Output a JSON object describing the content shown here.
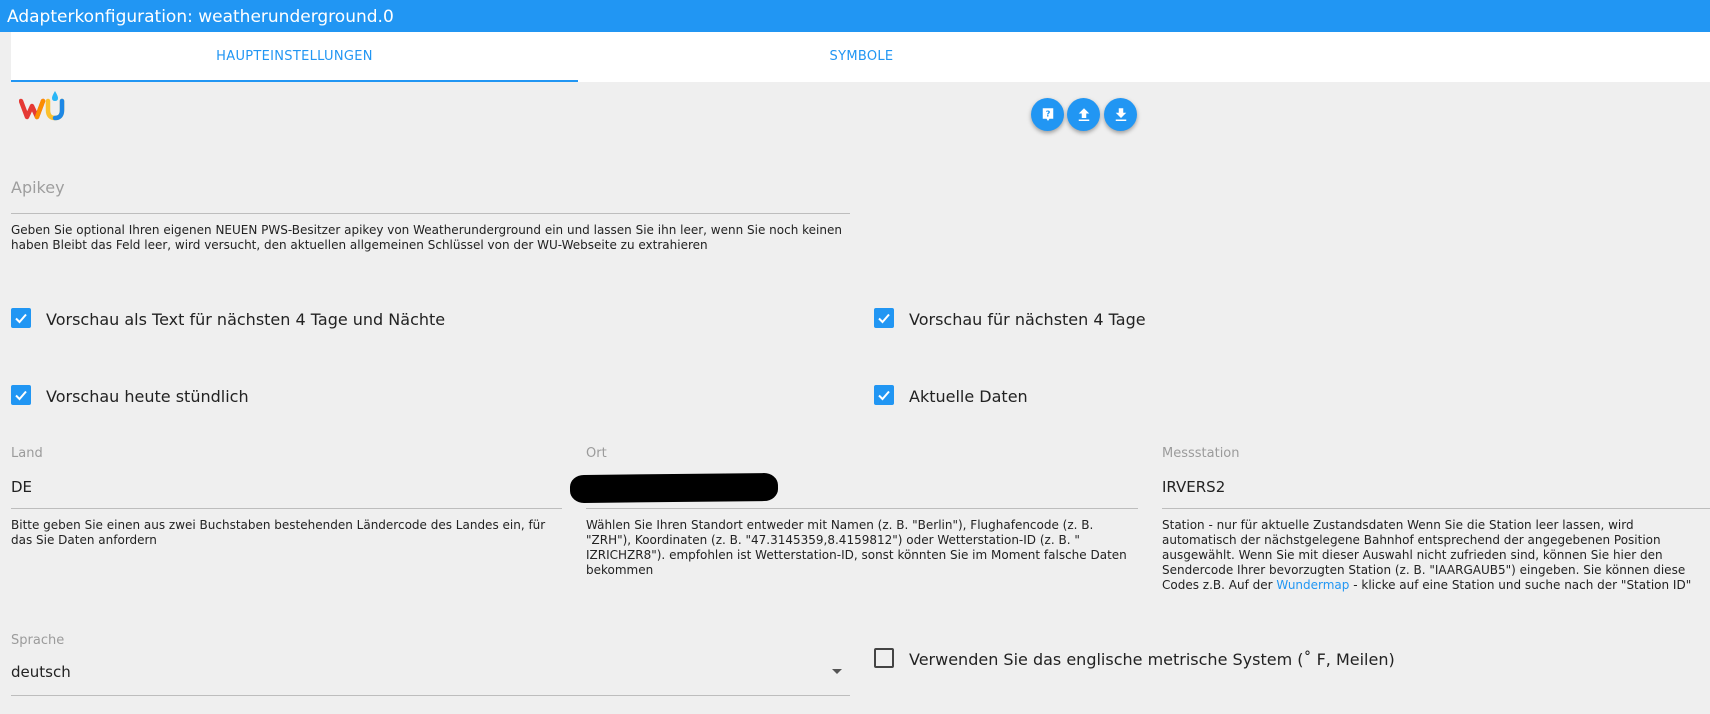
{
  "window": {
    "title": "Adapterkonfiguration: weatherunderground.0"
  },
  "tabs": [
    {
      "label": "HAUPTEINSTELLUNGEN",
      "active": true
    },
    {
      "label": "SYMBOLE",
      "active": false
    }
  ],
  "logo": {
    "text": "wu"
  },
  "toolbar": {
    "help_icon": "help-icon",
    "upload_icon": "upload-icon",
    "download_icon": "download-icon"
  },
  "apikey": {
    "placeholder": "Apikey",
    "value": "",
    "help": "Geben Sie optional Ihren eigenen NEUEN PWS-Besitzer apikey von Weatherunderground ein und lassen Sie ihn leer, wenn Sie noch keinen haben Bleibt das Feld leer, wird versucht, den aktuellen allgemeinen Schlüssel von der WU-Webseite zu extrahieren"
  },
  "checkboxes": {
    "forecast_text": {
      "label": "Vorschau als Text für nächsten 4 Tage und Nächte",
      "checked": true
    },
    "forecast_days": {
      "label": "Vorschau für nächsten 4 Tage",
      "checked": true
    },
    "forecast_hourly": {
      "label": "Vorschau heute stündlich",
      "checked": true
    },
    "current_data": {
      "label": "Aktuelle Daten",
      "checked": true
    },
    "imperial": {
      "label": "Verwenden Sie das englische metrische System (˚ F, Meilen)",
      "checked": false
    }
  },
  "country": {
    "label": "Land",
    "value": "DE",
    "help": "Bitte geben Sie einen aus zwei Buchstaben bestehenden Ländercode des Landes ein, für das Sie Daten anfordern"
  },
  "city": {
    "label": "Ort",
    "value": "",
    "help": "Wählen Sie Ihren Standort entweder mit Namen (z. B. \"Berlin\"), Flughafencode (z. B. \"ZRH\"), Koordinaten (z. B. \"47.3145359,8.4159812\") oder Wetterstation-ID (z. B. \" IZRICHZR8\"). empfohlen ist Wetterstation-ID, sonst könnten Sie im Moment falsche Daten bekommen"
  },
  "station": {
    "label": "Messstation",
    "value": "IRVERS2",
    "help_before": "Station - nur für aktuelle Zustandsdaten Wenn Sie die Station leer lassen, wird automatisch der nächstgelegene Bahnhof entsprechend der angegebenen Position ausgewählt. Wenn Sie mit dieser Auswahl nicht zufrieden sind, können Sie hier den Sendercode Ihrer bevorzugten Station (z. B. \"IAARGAUB5\") eingeben. Sie können diese Codes z.B. Auf der ",
    "help_link": "Wundermap",
    "help_after": " - klicke auf eine Station und suche nach der \"Station ID\""
  },
  "language": {
    "label": "Sprache",
    "value": "deutsch"
  },
  "colors": {
    "accent": "#2196f3",
    "background": "#efefef"
  }
}
